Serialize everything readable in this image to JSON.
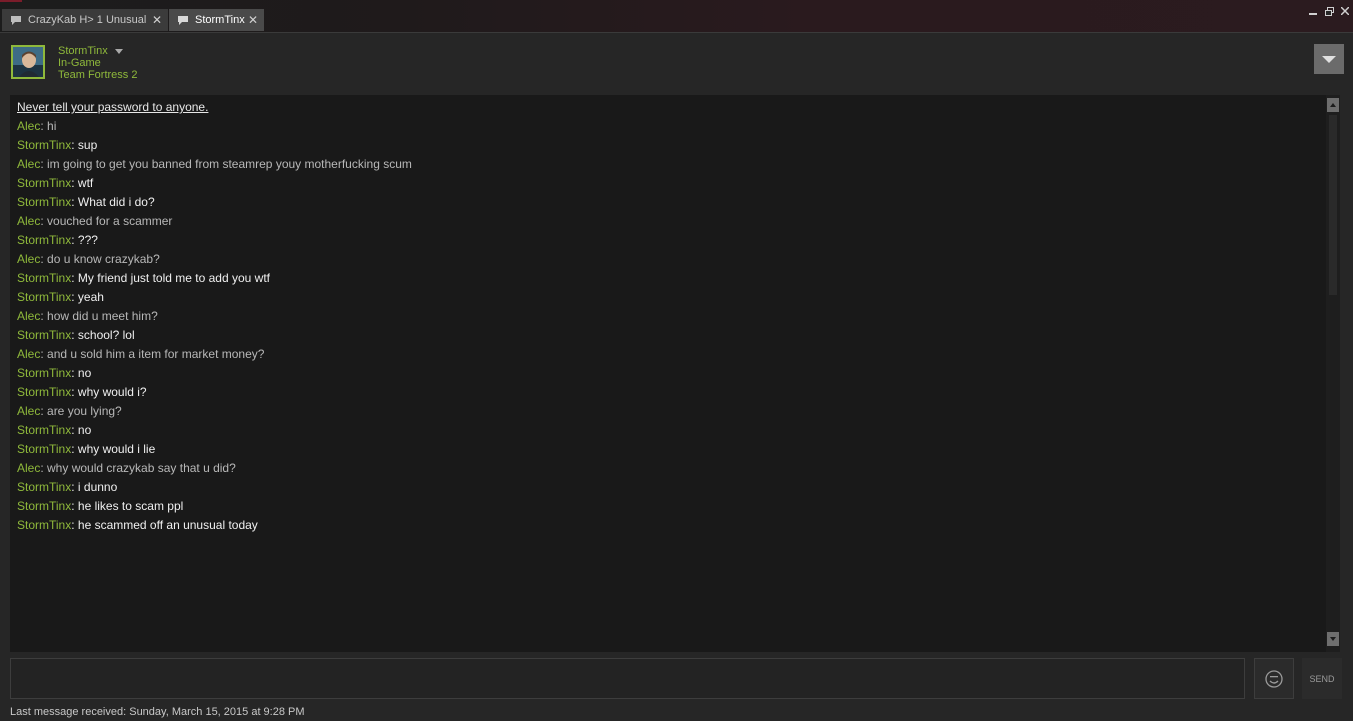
{
  "tabs": [
    {
      "label": "CrazyKab H> 1 Unusual",
      "active": false
    },
    {
      "label": "StormTinx",
      "active": true
    }
  ],
  "friend": {
    "name": "StormTinx",
    "status": "In-Game",
    "game": "Team Fortress 2"
  },
  "chat": {
    "warning": "Never tell your password to anyone.",
    "messages": [
      {
        "sender": "Alec",
        "text": "hi"
      },
      {
        "sender": "StormTinx",
        "text": "sup"
      },
      {
        "sender": "Alec",
        "text": "im going to get you banned from steamrep youy motherfucking scum"
      },
      {
        "sender": "StormTinx",
        "text": "wtf"
      },
      {
        "sender": "StormTinx",
        "text": "What did i do?"
      },
      {
        "sender": "Alec",
        "text": "vouched for a scammer"
      },
      {
        "sender": "StormTinx",
        "text": "???"
      },
      {
        "sender": "Alec",
        "text": "do u know crazykab?"
      },
      {
        "sender": "StormTinx",
        "text": "My friend just told me to add you wtf"
      },
      {
        "sender": "StormTinx",
        "text": "yeah"
      },
      {
        "sender": "Alec",
        "text": "how did u meet him?"
      },
      {
        "sender": "StormTinx",
        "text": "school? lol"
      },
      {
        "sender": "Alec",
        "text": "and u sold him a item for market money?"
      },
      {
        "sender": "StormTinx",
        "text": "no"
      },
      {
        "sender": "StormTinx",
        "text": "why would i?"
      },
      {
        "sender": "Alec",
        "text": "are you lying?"
      },
      {
        "sender": "StormTinx",
        "text": "no"
      },
      {
        "sender": "StormTinx",
        "text": "why would i lie"
      },
      {
        "sender": "Alec",
        "text": "why would crazykab say that u did?"
      },
      {
        "sender": "StormTinx",
        "text": "i dunno"
      },
      {
        "sender": "StormTinx",
        "text": "he likes to scam ppl"
      },
      {
        "sender": "StormTinx",
        "text": "he scammed off an unusual today"
      }
    ]
  },
  "input": {
    "value": "",
    "send_label": "SEND"
  },
  "footer": {
    "last_received": "Last message received: Sunday, March 15, 2015 at 9:28 PM"
  },
  "colors": {
    "accent_green": "#8fb93b",
    "background": "#262626",
    "chat_background": "#191919"
  }
}
